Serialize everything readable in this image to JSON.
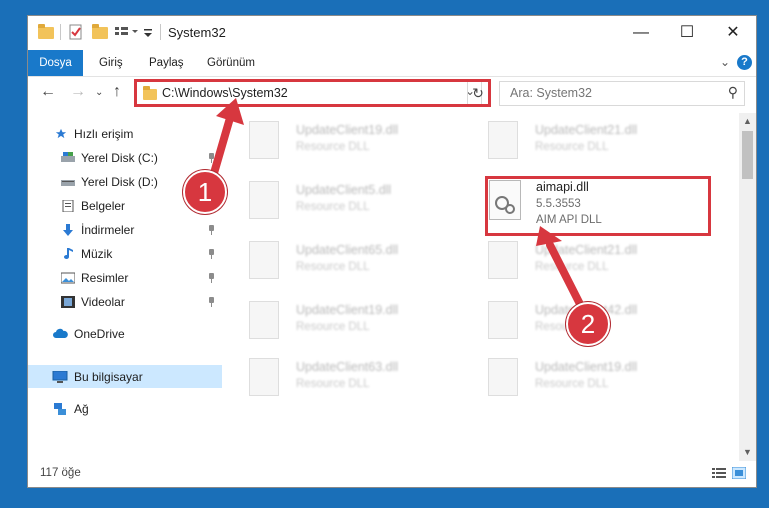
{
  "window": {
    "title": "System32",
    "controls": {
      "minimize": "—",
      "maximize": "☐",
      "close": "✕"
    }
  },
  "ribbon": {
    "tabs": [
      "Dosya",
      "Giriş",
      "Paylaş",
      "Görünüm"
    ],
    "help": "?"
  },
  "address": {
    "path": "C:\\Windows\\System32",
    "search_placeholder": "Ara: System32"
  },
  "sidebar": {
    "quick_access": "Hızlı erişim",
    "items": [
      {
        "label": "Yerel Disk (C:)",
        "icon": "drive-icon",
        "pinned": true
      },
      {
        "label": "Yerel Disk (D:)",
        "icon": "drive-icon",
        "pinned": true
      },
      {
        "label": "Belgeler",
        "icon": "documents-icon",
        "pinned": true
      },
      {
        "label": "İndirmeler",
        "icon": "downloads-icon",
        "pinned": true
      },
      {
        "label": "Müzik",
        "icon": "music-icon",
        "pinned": true
      },
      {
        "label": "Resimler",
        "icon": "pictures-icon",
        "pinned": true
      },
      {
        "label": "Videolar",
        "icon": "videos-icon",
        "pinned": true
      }
    ],
    "onedrive": "OneDrive",
    "this_pc": "Bu bilgisayar",
    "network": "Ağ"
  },
  "files": {
    "left_column": [
      {
        "name": "UpdateClient19.dll",
        "desc": "Resource DLL"
      },
      {
        "name": "UpdateClient5.dll",
        "desc": "Resource DLL"
      },
      {
        "name": "UpdateClient65.dll",
        "desc": "Resource DLL"
      },
      {
        "name": "UpdateClient19.dll",
        "desc": "Resource DLL"
      },
      {
        "name": "UpdateClient63.dll",
        "desc": "Resource DLL"
      }
    ],
    "right_column": [
      {
        "name": "UpdateClient21.dll",
        "desc": "Resource DLL"
      },
      {
        "name": "UpdateClient21.dll",
        "desc": "Resource DLL"
      },
      {
        "name": "UpdateClient42.dll",
        "desc": "Resource DLL"
      },
      {
        "name": "UpdateClient19.dll",
        "desc": "Resource DLL"
      }
    ],
    "highlighted": {
      "name": "aimapi.dll",
      "version": "5.5.3553",
      "desc": "AIM API DLL"
    }
  },
  "status": {
    "item_count": "117 öğe"
  },
  "callouts": [
    "1",
    "2"
  ],
  "colors": {
    "accent": "#1979ca",
    "highlight": "#d7373f",
    "selection": "#cce8ff"
  }
}
